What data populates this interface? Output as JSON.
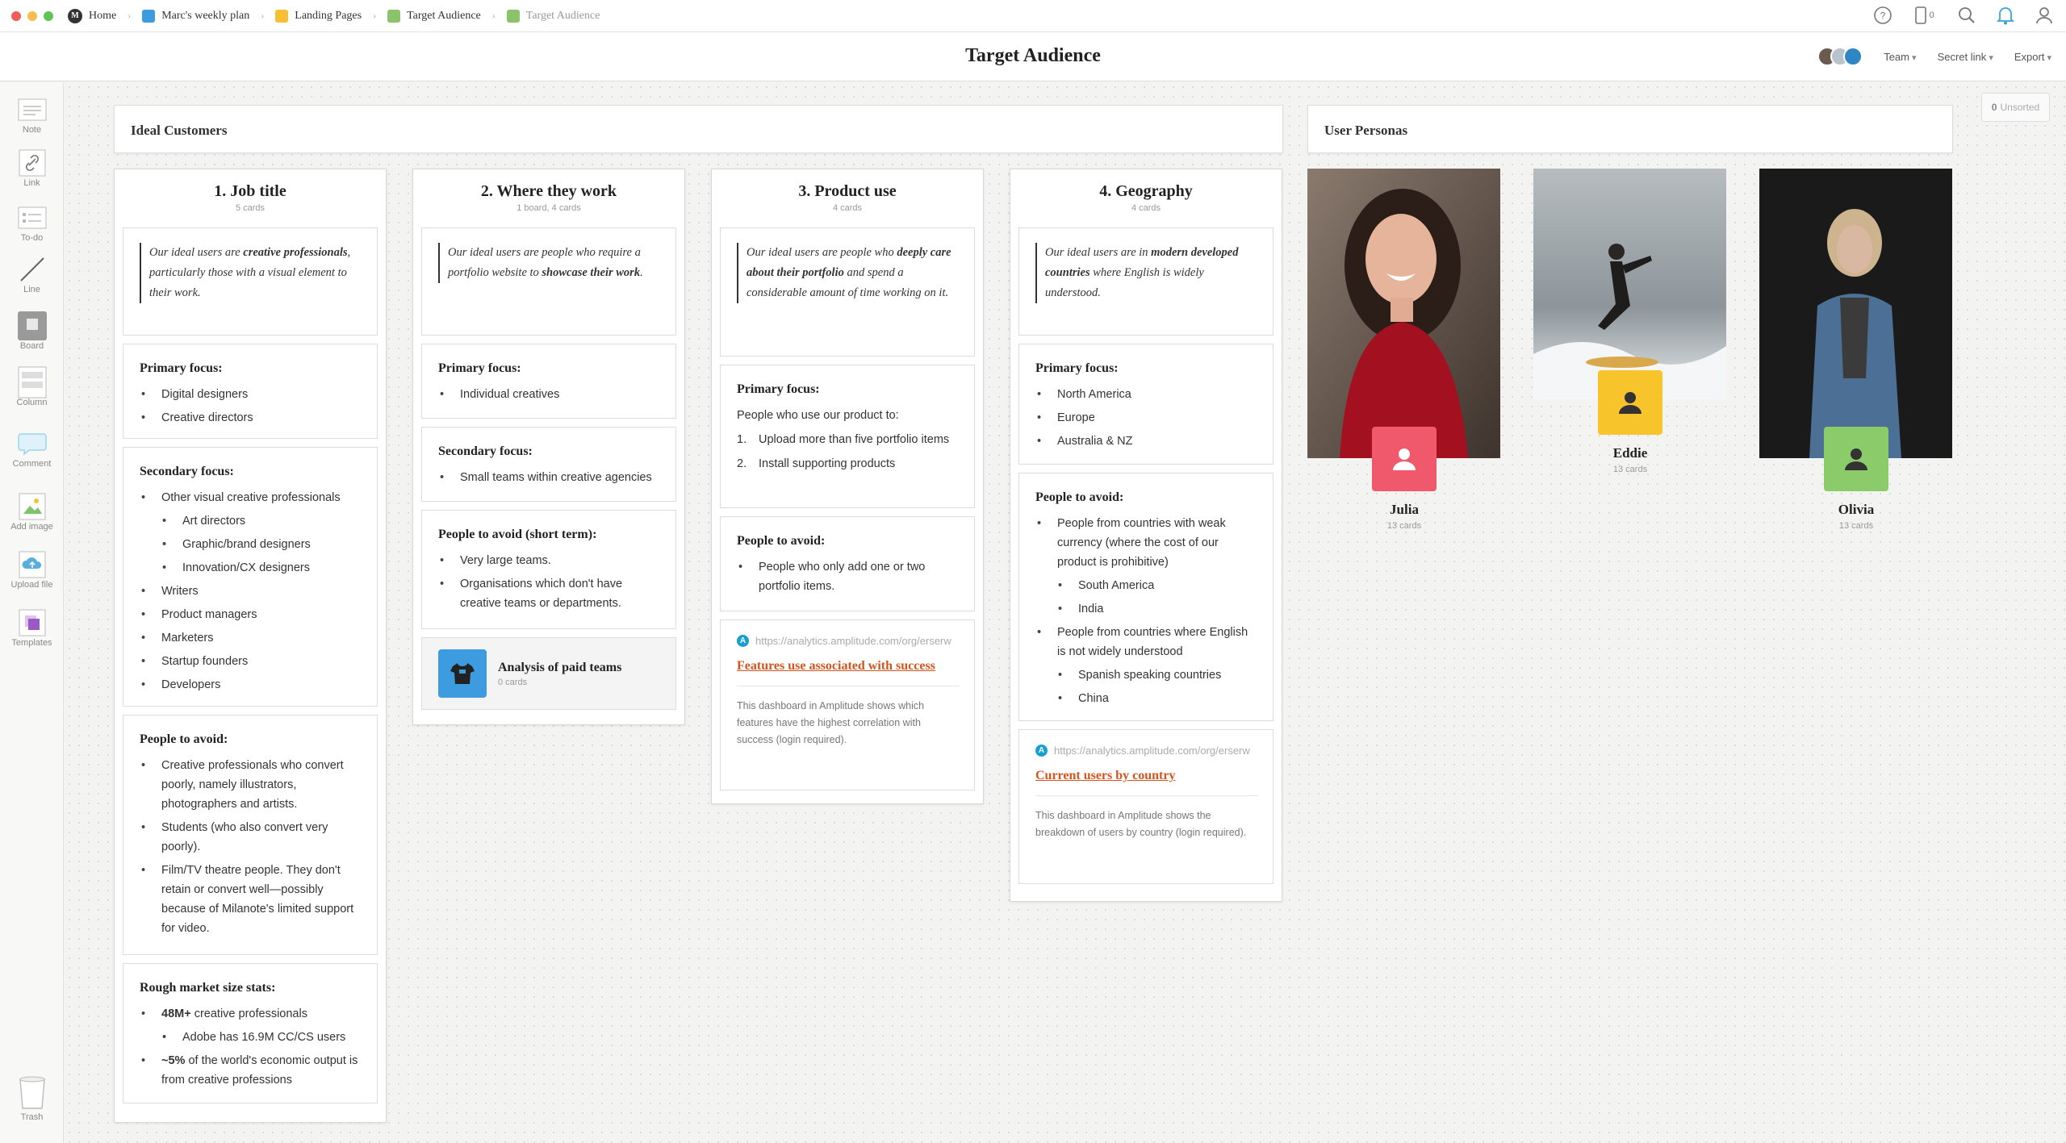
{
  "window": {
    "breadcrumbs": [
      {
        "label": "Home",
        "color": "#333333"
      },
      {
        "label": "Marc's weekly plan",
        "color": "#3d9be0"
      },
      {
        "label": "Landing Pages",
        "color": "#f5c033"
      },
      {
        "label": "Target Audience",
        "color": "#8bc36b"
      },
      {
        "label": "Target Audience",
        "color": "#8bc36b"
      }
    ],
    "mobile_count": "0"
  },
  "header": {
    "title": "Target Audience",
    "team_label": "Team",
    "secret_link_label": "Secret link",
    "export_label": "Export"
  },
  "toolbar": {
    "note": "Note",
    "link": "Link",
    "todo": "To-do",
    "line": "Line",
    "board": "Board",
    "column": "Column",
    "comment": "Comment",
    "add_image": "Add image",
    "upload_file": "Upload file",
    "templates": "Templates",
    "trash": "Trash"
  },
  "unsorted": {
    "count": "0",
    "label": "Unsorted"
  },
  "sections": {
    "ideal_customers": "Ideal Customers",
    "user_personas": "User Personas"
  },
  "columns": {
    "job": {
      "title": "1. Job title",
      "sub": "5 cards",
      "quote": {
        "a": "Our ideal users are ",
        "b": "creative professionals",
        "c": ", particularly those with a visual element to their work."
      },
      "primary": {
        "title": "Primary focus:",
        "items": [
          "Digital designers",
          "Creative directors"
        ]
      },
      "secondary": {
        "title": "Secondary focus:",
        "items": [
          "Other visual creative professionals",
          "Art directors",
          "Graphic/brand designers",
          "Innovation/CX designers",
          "Writers",
          "Product managers",
          "Marketers",
          "Startup founders",
          "Developers"
        ]
      },
      "avoid": {
        "title": "People to avoid:",
        "items": [
          "Creative professionals who convert poorly, namely illustrators, photographers and artists.",
          "Students (who also convert very poorly).",
          "Film/TV theatre people. They don't retain or convert well—possibly because of Milanote's limited support for video."
        ]
      },
      "market": {
        "title": "Rough market size stats:",
        "i1b": "48M+",
        "i1": " creative professionals",
        "i2": "Adobe has 16.9M CC/CS users",
        "i3b": "~5%",
        "i3": " of the world's economic output is from creative professions"
      }
    },
    "where": {
      "title": "2. Where they work",
      "sub": "1 board, 4 cards",
      "quote": {
        "a": "Our ideal users are people who require a portfolio website to ",
        "b": "showcase their work",
        "c": "."
      },
      "primary": {
        "title": "Primary focus:",
        "items": [
          "Individual creatives"
        ]
      },
      "secondary": {
        "title": "Secondary focus:",
        "items": [
          "Small teams within creative agencies"
        ]
      },
      "avoid": {
        "title": "People to avoid (short term):",
        "items": [
          "Very large teams.",
          "Organisations which don't have creative teams or departments."
        ]
      },
      "board": {
        "title": "Analysis of paid teams",
        "sub": "0 cards"
      }
    },
    "product": {
      "title": "3. Product use",
      "sub": "4 cards",
      "quote": {
        "a": "Our ideal users are people who ",
        "b": "deeply care about their portfolio",
        "c": " and spend a considerable amount of time working on it."
      },
      "primary": {
        "title": "Primary focus:",
        "intro": "People who use our product to:",
        "items": [
          "Upload more than five portfolio items",
          "Install supporting products"
        ]
      },
      "avoid": {
        "title": "People to avoid:",
        "items": [
          "People who only add one or two portfolio items."
        ]
      },
      "link": {
        "url": "https://analytics.amplitude.com/org/erserw",
        "title": "Features use associated with success",
        "desc": "This dashboard in Amplitude shows which features have the highest correlation with success (login required)."
      }
    },
    "geo": {
      "title": "4. Geography",
      "sub": "4 cards",
      "quote": {
        "a": "Our ideal users are in ",
        "b": "modern developed countries",
        "c": " where English is widely understood."
      },
      "primary": {
        "title": "Primary focus:",
        "items": [
          "North America",
          "Europe",
          "Australia & NZ"
        ]
      },
      "avoid": {
        "title": "People to avoid:",
        "items": [
          "People from countries with weak currency (where the cost of our product is prohibitive)",
          "South America",
          "India",
          "People from countries where English is not widely understood",
          "Spanish speaking countries",
          "China"
        ]
      },
      "link": {
        "url": "https://analytics.amplitude.com/org/erserw",
        "title": "Current users by country",
        "desc": "This dashboard in Amplitude shows the breakdown of users by country (login required)."
      }
    }
  },
  "personas": [
    {
      "name": "Julia",
      "count": "13 cards",
      "badge_color": "#f0596b"
    },
    {
      "name": "Eddie",
      "count": "13 cards",
      "badge_color": "#f8c42c"
    },
    {
      "name": "Olivia",
      "count": "13 cards",
      "badge_color": "#8ccb6a"
    }
  ]
}
